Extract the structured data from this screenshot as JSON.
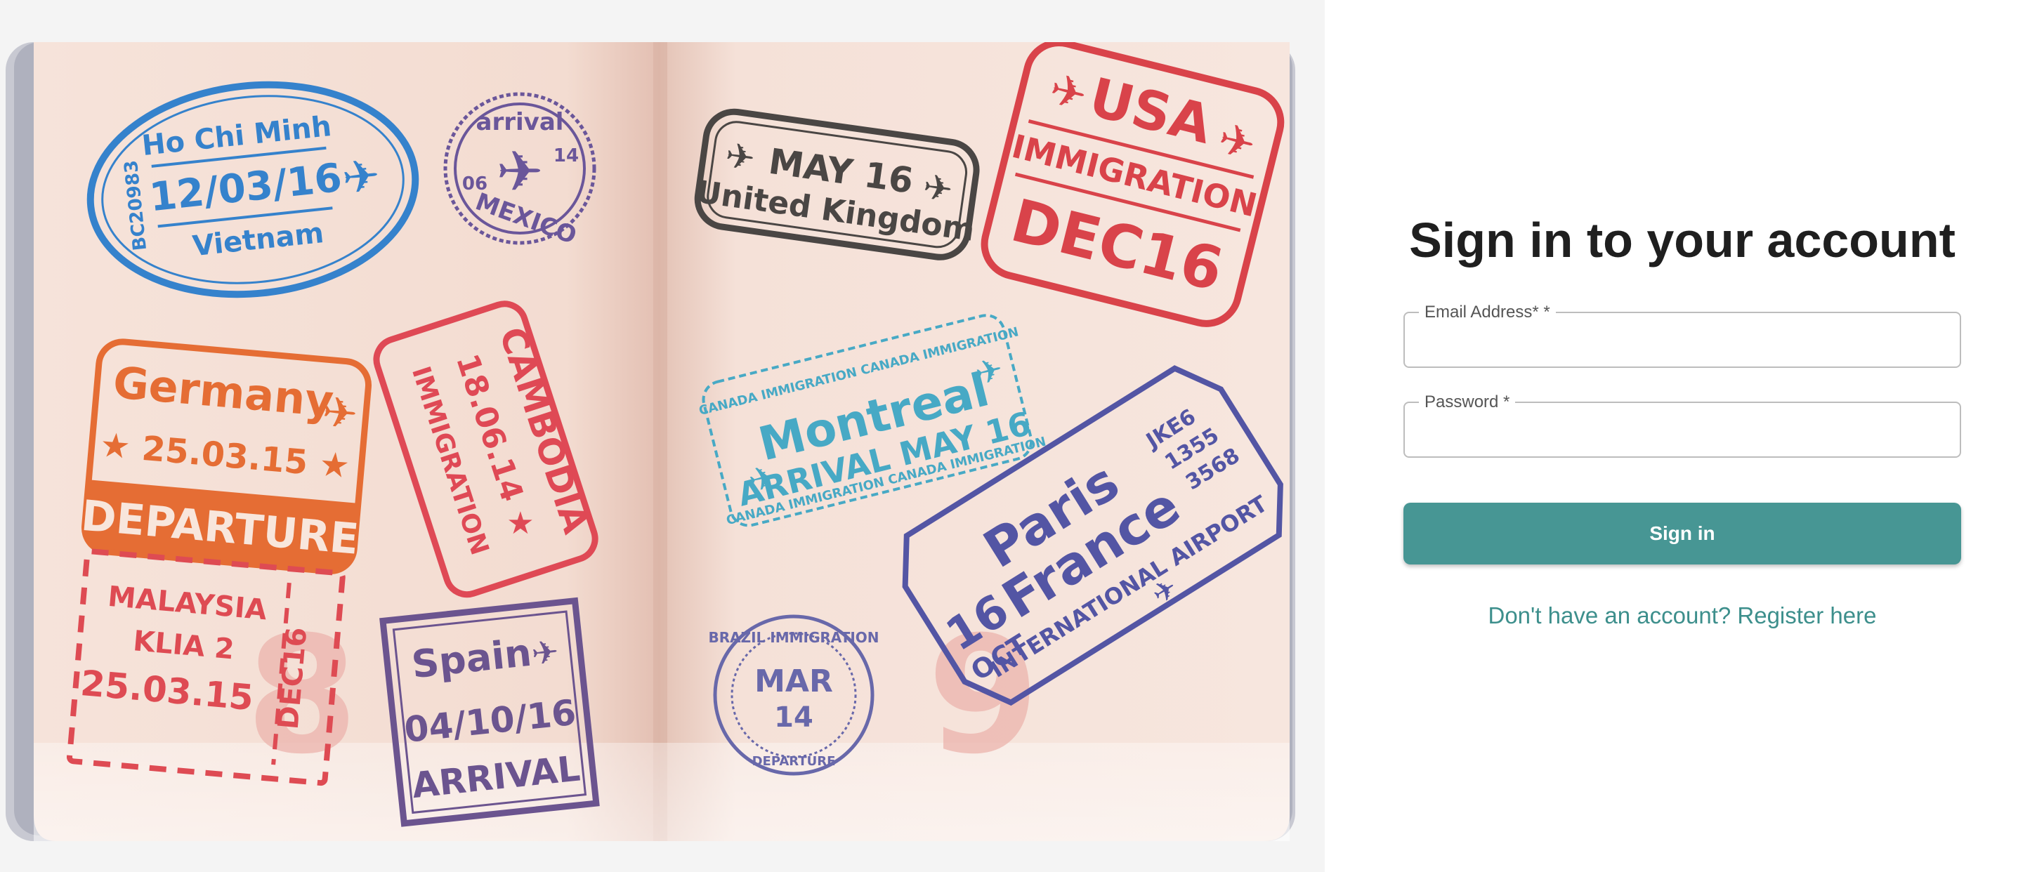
{
  "hero": {
    "stamps": {
      "hochiminh": {
        "city": "Ho Chi Minh",
        "date": "12/03/16",
        "country": "Vietnam",
        "code": "BC20983"
      },
      "mexico": {
        "top": "arrival",
        "left": "06",
        "right": "14",
        "bottom": "MEXICO"
      },
      "uk": {
        "date": "MAY 16",
        "country": "United Kingdom"
      },
      "usa": {
        "country": "USA",
        "label": "IMMIGRATION",
        "date": "DEC16"
      },
      "germany": {
        "country": "Germany",
        "date": "25.03.15",
        "label": "DEPARTURE"
      },
      "cambodia": {
        "country": "CAMBODIA",
        "date": "18.06.14",
        "label": "IMMIGRATION"
      },
      "montreal": {
        "city": "Montreal",
        "label": "ARRIVAL MAY 16",
        "ring": "CANADA IMMIGRATION"
      },
      "paris": {
        "day": "16",
        "month": "OCT",
        "city": "Paris",
        "country": "France",
        "airport": "INTERNATIONAL AIRPORT",
        "codes": [
          "JKE6",
          "1355",
          "3568"
        ]
      },
      "malaysia": {
        "country": "MALAYSIA",
        "place": "KLIA 2",
        "date": "25.03.15",
        "side": "DEC16"
      },
      "spain": {
        "country": "Spain",
        "date": "04/10/16",
        "label": "ARRIVAL"
      },
      "brazil": {
        "ring": "BRAZIL IMMIGRATION",
        "month": "MAR",
        "day": "14",
        "outer": "DEPARTURE"
      }
    },
    "page_numbers": {
      "left": "8",
      "right": "9"
    }
  },
  "form": {
    "title": "Sign in to your account",
    "email_label": "Email Address* *",
    "email_value": "",
    "password_label": "Password *",
    "password_value": "",
    "submit_label": "Sign in",
    "register_link": "Don't have an account? Register here"
  },
  "colors": {
    "accent": "#479694",
    "link": "#3d8f8c",
    "title": "#1f1f1f"
  }
}
